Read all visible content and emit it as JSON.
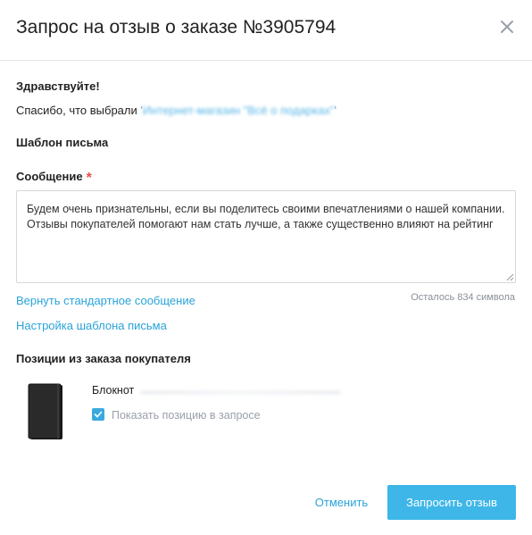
{
  "dialog": {
    "title": "Запрос на отзыв о заказе №3905794"
  },
  "greeting": {
    "hello": "Здравствуйте!",
    "thanks_prefix": "Спасибо, что выбрали",
    "company_link": "Интернет-магазин \"Всё о подарках\""
  },
  "template": {
    "section_title": "Шаблон письма"
  },
  "message": {
    "label": "Сообщение",
    "required_mark": "*",
    "text": "Будем очень признательны, если вы поделитесь своими впечатлениями о нашей компании. Отзывы покупателей помогают нам стать лучше, а также существенно влияют на рейтинг",
    "reset_link": "Вернуть стандартное сообщение",
    "counter": "Осталось 834 символа",
    "settings_link": "Настройка шаблона письма"
  },
  "items": {
    "section_title": "Позиции из заказа покупателя",
    "list": [
      {
        "name": "Блокнот",
        "icon": "notebook-image",
        "show_in_request": true,
        "show_label": "Показать позицию в запросе"
      }
    ]
  },
  "footer": {
    "cancel_label": "Отменить",
    "submit_label": "Запросить отзыв"
  },
  "colors": {
    "accent": "#2aa3d9",
    "primary_button": "#3eb6e8",
    "required": "#e8524a"
  }
}
